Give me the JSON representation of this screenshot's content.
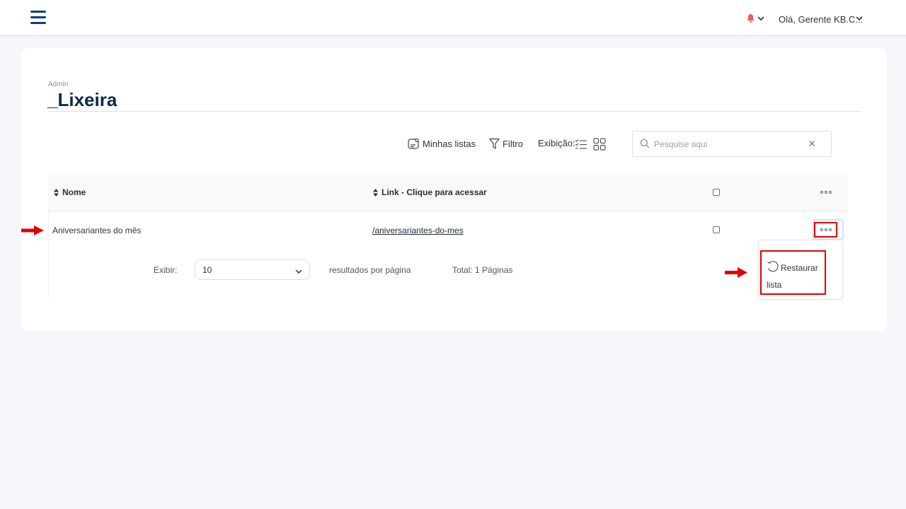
{
  "header": {
    "menu_icon": "hamburger-menu-icon",
    "notification_icon": "bell-icon",
    "user_greeting": "Olá, Gerente KB.C...",
    "brand_color": "#0d3c8c",
    "bell_color": "#f05a5a"
  },
  "page": {
    "breadcrumb": "Admin",
    "title": "_Lixeira"
  },
  "toolbar": {
    "my_lists_label": "Minhas listas",
    "filter_label": "Filtro",
    "view_label": "Exibição:",
    "view_list_icon": "list-view-icon",
    "view_grid_icon": "grid-view-icon"
  },
  "search": {
    "placeholder": "Pesquise aqui",
    "value": ""
  },
  "table": {
    "columns": [
      "Nome",
      "Link - Clique para acessar"
    ],
    "rows": [
      {
        "name": "Aniversariantes do mês",
        "link": "/aniversariantes-do-mes"
      }
    ]
  },
  "row_menu": {
    "items": [
      {
        "label": "Restaurar lista",
        "icon": "restore-icon"
      }
    ]
  },
  "pagination": {
    "show_label": "Exibir:",
    "page_size": "10",
    "per_page_label": "resultados por página",
    "total_label": "Total: 1 Páginas"
  },
  "annotation_color": "#e00000"
}
